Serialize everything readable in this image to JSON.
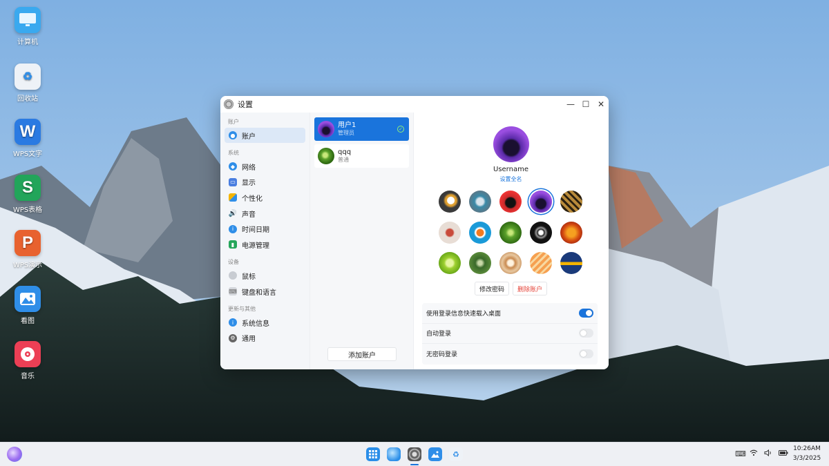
{
  "desktop": {
    "icons": [
      {
        "label": "计算机",
        "icon": "computer-icon",
        "color": "#3aa9ef"
      },
      {
        "label": "回收站",
        "icon": "recycle-bin-icon",
        "color": "#e8ecf2"
      },
      {
        "label": "WPS文字",
        "icon": "wps-writer-icon",
        "glyph": "W",
        "color": "#2a7ae2"
      },
      {
        "label": "WPS表格",
        "icon": "wps-sheet-icon",
        "glyph": "S",
        "color": "#22a55a"
      },
      {
        "label": "WPS演示",
        "icon": "wps-presentation-icon",
        "glyph": "P",
        "color": "#e8622f"
      },
      {
        "label": "看图",
        "icon": "image-viewer-icon",
        "color": "#2f8ee8"
      },
      {
        "label": "音乐",
        "icon": "music-icon",
        "color": "#ec3f55"
      }
    ]
  },
  "window": {
    "title": "设置",
    "sidebar": {
      "sections": [
        {
          "title": "账户",
          "items": [
            {
              "label": "账户",
              "icon": "user-icon",
              "active": true
            }
          ]
        },
        {
          "title": "系统",
          "items": [
            {
              "label": "网络",
              "icon": "network-icon"
            },
            {
              "label": "显示",
              "icon": "display-icon"
            },
            {
              "label": "个性化",
              "icon": "personalize-icon"
            },
            {
              "label": "声音",
              "icon": "sound-icon"
            },
            {
              "label": "时间日期",
              "icon": "clock-icon"
            },
            {
              "label": "电源管理",
              "icon": "battery-icon"
            }
          ]
        },
        {
          "title": "设备",
          "items": [
            {
              "label": "鼠标",
              "icon": "mouse-icon"
            },
            {
              "label": "键盘和语言",
              "icon": "keyboard-icon"
            }
          ]
        },
        {
          "title": "更新与其他",
          "items": [
            {
              "label": "系统信息",
              "icon": "info-icon"
            },
            {
              "label": "通用",
              "icon": "gear-icon"
            }
          ]
        }
      ]
    },
    "users": [
      {
        "name": "用户1",
        "role": "管理员",
        "active": true
      },
      {
        "name": "qqq",
        "role": "普通",
        "active": false
      }
    ],
    "add_account_label": "添加账户",
    "detail": {
      "username": "Username",
      "set_fullname": "设置全名",
      "change_password": "修改密码",
      "delete_account": "删除账户",
      "options": [
        {
          "label": "使用登录信息快速载入桌面",
          "enabled": true
        },
        {
          "label": "自动登录",
          "enabled": false
        },
        {
          "label": "无密码登录",
          "enabled": false
        }
      ]
    }
  },
  "taskbar": {
    "apps": [
      "launcher-icon",
      "browser-icon",
      "settings-icon",
      "image-viewer-icon",
      "recycle-bin-icon"
    ],
    "time": "10:26AM",
    "date": "3/3/2025"
  },
  "colors": {
    "accent": "#1a74dc",
    "danger": "#e5443a"
  }
}
